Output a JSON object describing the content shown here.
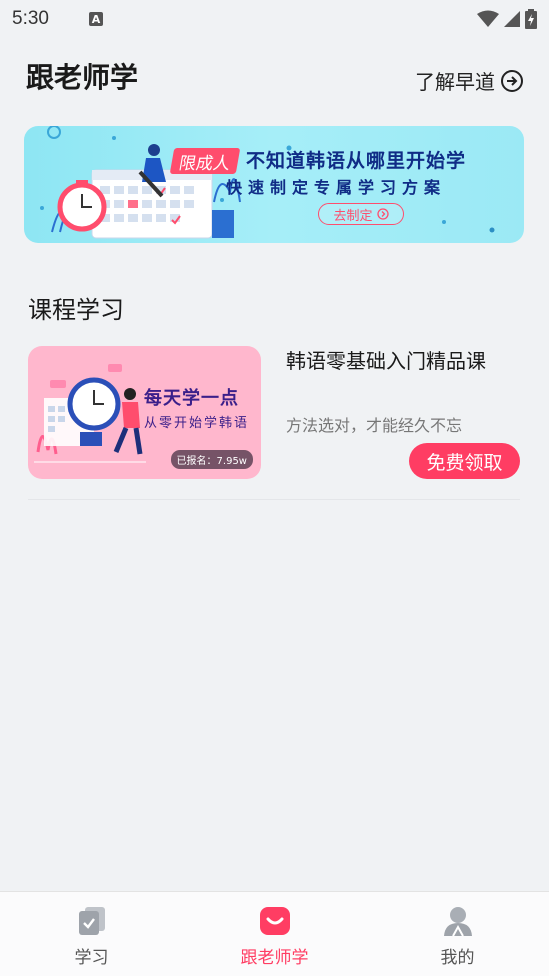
{
  "status_bar": {
    "time": "5:30",
    "notification_letter": "A"
  },
  "header": {
    "title": "跟老师学",
    "link_label": "了解早道"
  },
  "banner": {
    "tag": "限成人",
    "line1": "不知道韩语从哪里开始学",
    "line2": "快速制定专属学习方案",
    "button_label": "去制定"
  },
  "section": {
    "title": "课程学习"
  },
  "course": {
    "thumb_line1": "每天学一点",
    "thumb_line2": "从零开始学韩语",
    "enrolled": "已报名：7.95w",
    "title": "韩语零基础入门精品课",
    "subtitle": "方法选对，才能经久不忘",
    "button_label": "免费领取"
  },
  "nav": {
    "items": [
      {
        "label": "学习",
        "icon": "study-icon"
      },
      {
        "label": "跟老师学",
        "icon": "teacher-icon"
      },
      {
        "label": "我的",
        "icon": "profile-icon"
      }
    ],
    "active_index": 1
  },
  "colors": {
    "accent": "#ff3d63",
    "banner_text": "#102c86",
    "background": "#f0f2f4"
  }
}
